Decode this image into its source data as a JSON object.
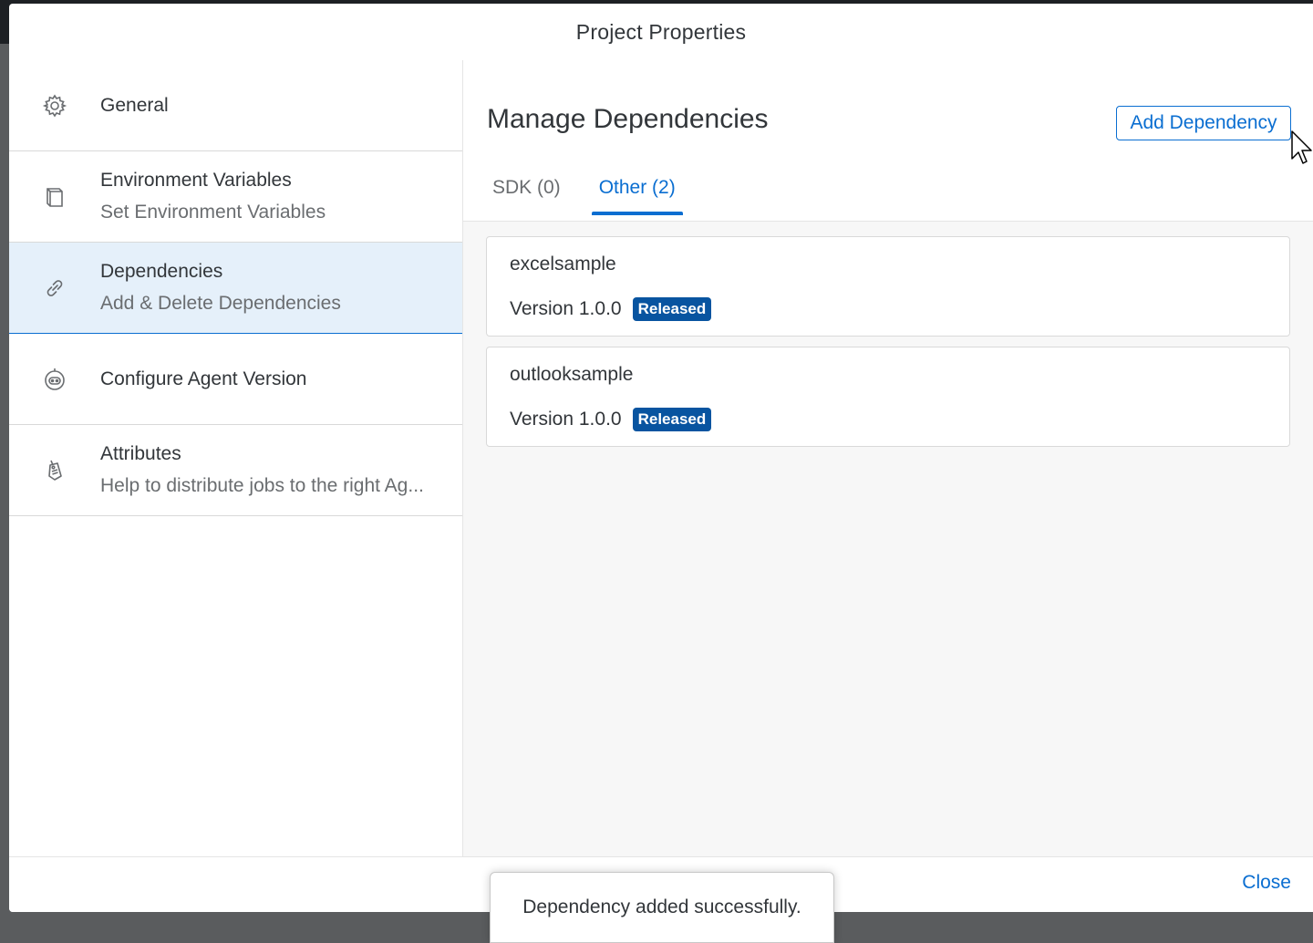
{
  "dialog": {
    "title": "Project Properties"
  },
  "nav": {
    "items": [
      {
        "title": "General",
        "description": "",
        "icon": "gear-icon"
      },
      {
        "title": "Environment Variables",
        "description": "Set Environment Variables",
        "icon": "document-icon"
      },
      {
        "title": "Dependencies",
        "description": "Add & Delete Dependencies",
        "icon": "link-icon",
        "selected": true
      },
      {
        "title": "Configure Agent Version",
        "description": "",
        "icon": "robot-icon"
      },
      {
        "title": "Attributes",
        "description": "Help to distribute jobs to the right Ag...",
        "icon": "tag-icon"
      }
    ]
  },
  "content": {
    "title": "Manage Dependencies",
    "add_button_label": "Add Dependency",
    "tabs": [
      {
        "label": "SDK (0)",
        "active": false
      },
      {
        "label": "Other (2)",
        "active": true
      }
    ],
    "dependencies": [
      {
        "name": "excelsample",
        "version": "Version 1.0.0",
        "status": "Released"
      },
      {
        "name": "outlooksample",
        "version": "Version 1.0.0",
        "status": "Released"
      }
    ]
  },
  "footer": {
    "close_label": "Close"
  },
  "toast": {
    "message": "Dependency added successfully."
  },
  "colors": {
    "accent": "#0a6ed1",
    "badge": "#0854a0",
    "selected_bg": "#e5f0fa"
  }
}
